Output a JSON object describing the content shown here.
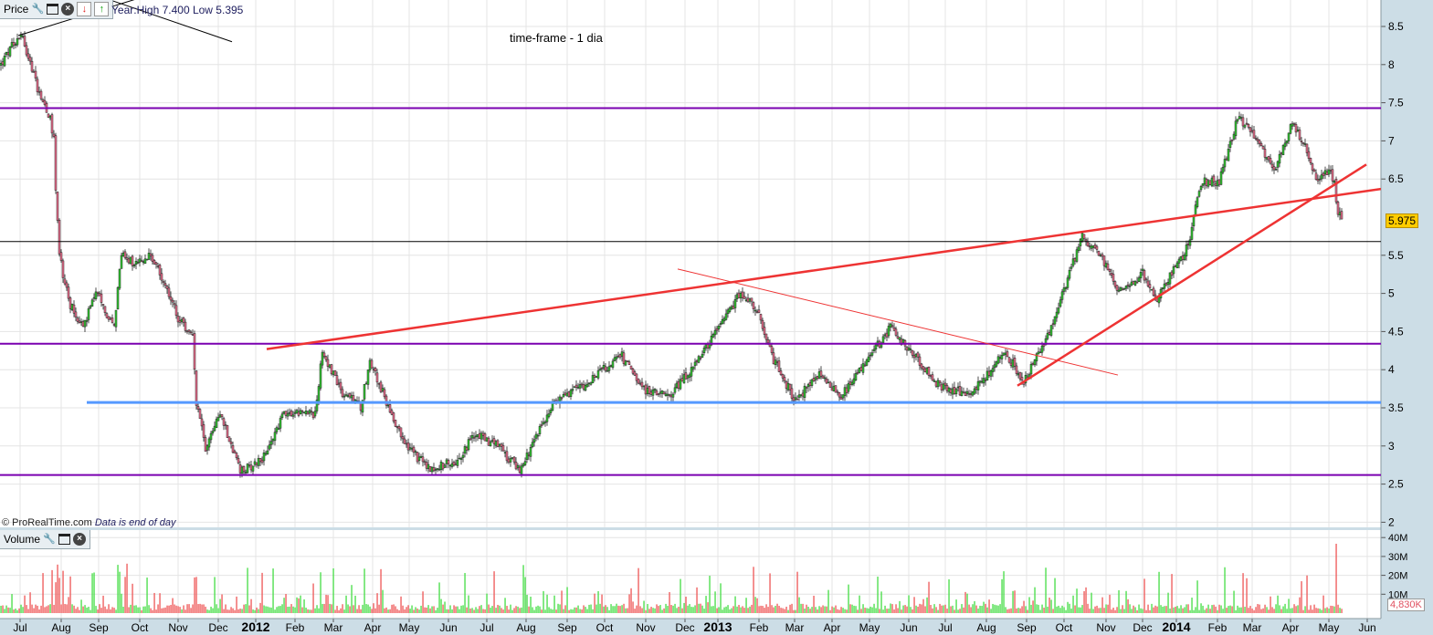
{
  "header": {
    "panel_label": "Price",
    "year_info": "Year:High 7.400 Low 5.395",
    "chart_title": "time-frame -  1 dia",
    "copyright": "© ProRealTime.com",
    "data_note": "Data is end of day"
  },
  "volume_panel": {
    "panel_label": "Volume",
    "last_volume": "4,830K"
  },
  "colors": {
    "up": "#33cc33",
    "down": "#ee7090",
    "vol_up": "#44dd44",
    "vol_down": "#ee5555",
    "support_purple": "#7a00b0",
    "support_blue": "#5599ff",
    "trend_red": "#ee3333",
    "axis_bg": "#ccdde6"
  },
  "chart_data": {
    "type": "candlestick",
    "title": "time-frame -  1 dia",
    "last_price": "5.975",
    "x_unit": "trading day index",
    "price_ylim": [
      2,
      8.5
    ],
    "price_ticks": [
      "2",
      "2.5",
      "3",
      "3.5",
      "4",
      "4.5",
      "5",
      "5.5",
      "6.5",
      "7",
      "7.5",
      "8",
      "8.5"
    ],
    "volume_ylim": [
      0,
      40000000
    ],
    "volume_ticks": [
      {
        "v": 10000000,
        "label": "10M"
      },
      {
        "v": 20000000,
        "label": "20M"
      },
      {
        "v": 30000000,
        "label": "30M"
      },
      {
        "v": 40000000,
        "label": "40M"
      }
    ],
    "x_ticks": [
      {
        "d": 11,
        "label": "Jul"
      },
      {
        "d": 33.5,
        "label": "Aug"
      },
      {
        "d": 54,
        "label": "Sep"
      },
      {
        "d": 76.5,
        "label": "Oct"
      },
      {
        "d": 97.5,
        "label": "Nov"
      },
      {
        "d": 119.5,
        "label": "Dec"
      },
      {
        "d": 140,
        "label": "2012",
        "bold": true
      },
      {
        "d": 161.5,
        "label": "Feb"
      },
      {
        "d": 182.5,
        "label": "Mar"
      },
      {
        "d": 204,
        "label": "Apr"
      },
      {
        "d": 224,
        "label": "May"
      },
      {
        "d": 245.5,
        "label": "Jun"
      },
      {
        "d": 266.5,
        "label": "Jul"
      },
      {
        "d": 288,
        "label": "Aug"
      },
      {
        "d": 310.5,
        "label": "Sep"
      },
      {
        "d": 331,
        "label": "Oct"
      },
      {
        "d": 353.5,
        "label": "Nov"
      },
      {
        "d": 375,
        "label": "Dec"
      },
      {
        "d": 393,
        "label": "2013",
        "bold": true
      },
      {
        "d": 415.5,
        "label": "Feb"
      },
      {
        "d": 435,
        "label": "Mar"
      },
      {
        "d": 455.5,
        "label": "Apr"
      },
      {
        "d": 476,
        "label": "May"
      },
      {
        "d": 497.5,
        "label": "Jun"
      },
      {
        "d": 517.5,
        "label": "Jul"
      },
      {
        "d": 540,
        "label": "Aug"
      },
      {
        "d": 562,
        "label": "Sep"
      },
      {
        "d": 582.5,
        "label": "Oct"
      },
      {
        "d": 605.5,
        "label": "Nov"
      },
      {
        "d": 625.5,
        "label": "Dec"
      },
      {
        "d": 644,
        "label": "2014",
        "bold": true
      },
      {
        "d": 666.5,
        "label": "Feb"
      },
      {
        "d": 685.5,
        "label": "Mar"
      },
      {
        "d": 706.5,
        "label": "Apr"
      },
      {
        "d": 727.5,
        "label": "May"
      },
      {
        "d": 748.5,
        "label": "Jun"
      }
    ],
    "price_path": [
      [
        0,
        8.0
      ],
      [
        11,
        8.43
      ],
      [
        20,
        7.7
      ],
      [
        27,
        7.3
      ],
      [
        29,
        7.0
      ],
      [
        30,
        6.35
      ],
      [
        32,
        5.5
      ],
      [
        37,
        4.9
      ],
      [
        45,
        4.55
      ],
      [
        52,
        5.0
      ],
      [
        62,
        4.55
      ],
      [
        66,
        5.5
      ],
      [
        75,
        5.38
      ],
      [
        82,
        5.5
      ],
      [
        90,
        5.14
      ],
      [
        97,
        4.66
      ],
      [
        105,
        4.42
      ],
      [
        107,
        3.58
      ],
      [
        112,
        2.99
      ],
      [
        120,
        3.46
      ],
      [
        131,
        2.65
      ],
      [
        145,
        2.87
      ],
      [
        155,
        3.46
      ],
      [
        172,
        3.4
      ],
      [
        176,
        4.24
      ],
      [
        187,
        3.7
      ],
      [
        197,
        3.52
      ],
      [
        202,
        4.12
      ],
      [
        212,
        3.52
      ],
      [
        222,
        2.99
      ],
      [
        235,
        2.69
      ],
      [
        250,
        2.81
      ],
      [
        260,
        3.17
      ],
      [
        272,
        2.99
      ],
      [
        284,
        2.69
      ],
      [
        295,
        3.22
      ],
      [
        302,
        3.58
      ],
      [
        320,
        3.82
      ],
      [
        340,
        4.18
      ],
      [
        350,
        3.76
      ],
      [
        365,
        3.64
      ],
      [
        380,
        4.06
      ],
      [
        395,
        4.6
      ],
      [
        405,
        5.02
      ],
      [
        415,
        4.72
      ],
      [
        422,
        4.18
      ],
      [
        435,
        3.58
      ],
      [
        447,
        3.94
      ],
      [
        460,
        3.64
      ],
      [
        472,
        4.06
      ],
      [
        487,
        4.55
      ],
      [
        500,
        4.18
      ],
      [
        515,
        3.76
      ],
      [
        532,
        3.7
      ],
      [
        550,
        4.24
      ],
      [
        560,
        3.82
      ],
      [
        575,
        4.55
      ],
      [
        585,
        5.26
      ],
      [
        592,
        5.74
      ],
      [
        605,
        5.38
      ],
      [
        612,
        5.02
      ],
      [
        625,
        5.26
      ],
      [
        632,
        4.9
      ],
      [
        650,
        5.62
      ],
      [
        657,
        6.46
      ],
      [
        667,
        6.46
      ],
      [
        677,
        7.3
      ],
      [
        687,
        7.06
      ],
      [
        697,
        6.63
      ],
      [
        707,
        7.23
      ],
      [
        715,
        6.87
      ],
      [
        720,
        6.46
      ],
      [
        727,
        6.63
      ],
      [
        730,
        6.46
      ],
      [
        732,
        6.04
      ],
      [
        734,
        5.975
      ]
    ],
    "horizontal_lines": [
      {
        "price": 7.43,
        "style": "purple"
      },
      {
        "price": 4.34,
        "style": "purple"
      },
      {
        "price": 2.62,
        "style": "purple"
      },
      {
        "price": 3.57,
        "style": "blue",
        "from": 47.5
      },
      {
        "price": 5.68,
        "style": "black"
      }
    ],
    "trend_lines": [
      {
        "from": [
          146,
          4.27
        ],
        "to": [
          756,
          6.37
        ],
        "style": "red-thick"
      },
      {
        "from": [
          371,
          5.32
        ],
        "to": [
          612,
          3.93
        ],
        "style": "red-thin"
      },
      {
        "from": [
          557,
          3.79
        ],
        "to": [
          748,
          6.69
        ],
        "style": "red-thick"
      },
      {
        "from": [
          10,
          8.38
        ],
        "to": [
          80,
          8.9
        ],
        "style": "black"
      },
      {
        "from": [
          60,
          8.85
        ],
        "to": [
          127,
          8.3
        ],
        "style": "black"
      }
    ]
  }
}
